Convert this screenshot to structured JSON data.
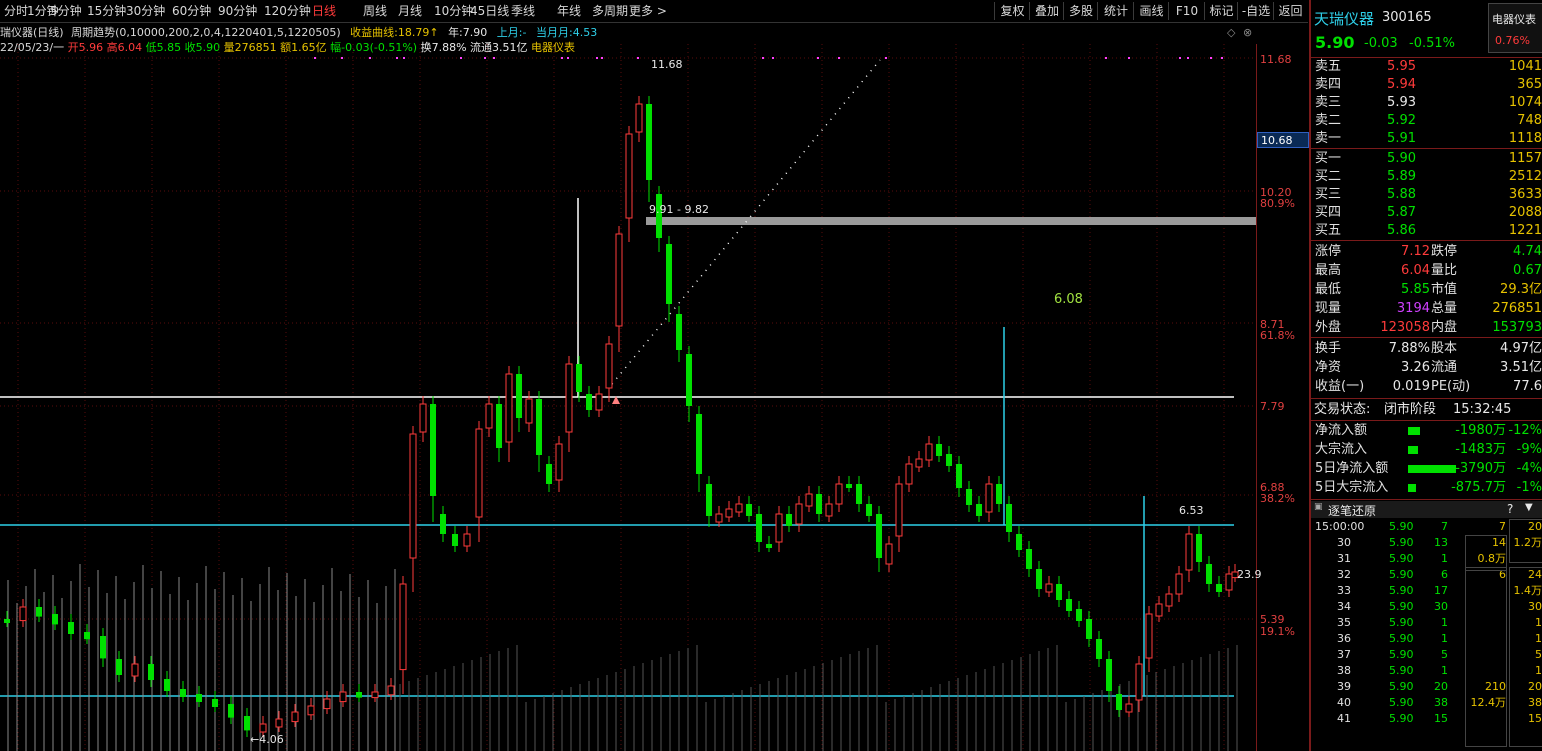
{
  "toolbar": {
    "periods": [
      "分时",
      "1分钟",
      "5分钟",
      "15分钟",
      "30分钟",
      "60分钟",
      "90分钟",
      "120分钟",
      "日线",
      "周线",
      "月线",
      "10分钟",
      "45日线",
      "季线",
      "年线",
      "多周期",
      "更多 >"
    ],
    "active_period": "日线",
    "tools": [
      "复权",
      "叠加",
      "多股",
      "统计",
      "画线",
      "F10",
      "标记",
      "-自选",
      "返回"
    ]
  },
  "info_line1": {
    "name": "瑞仪器(日线)",
    "indicator": "周期趋势(0,10000,200,2,0,4,1220401,5,1220505)",
    "curve_label": "收益曲线:",
    "curve_value": "18.79↑",
    "year_label": "年:",
    "year_value": "7.90",
    "lastmonth_label": "上月:",
    "lastmonth_value": "-",
    "thismonth_label": "当月月:",
    "thismonth_value": "4.53"
  },
  "info_line2": {
    "date": "22/05/23/一",
    "open_label": "开",
    "open": "5.96",
    "high_label": "高",
    "high": "6.04",
    "low_label": "低",
    "low": "5.85",
    "close_label": "收",
    "close": "5.90",
    "vol_label": "量",
    "vol": "276851",
    "amount_label": "额",
    "amount": "1.65亿",
    "chg_label": "幅",
    "chg": "-0.03(-0.51%)",
    "turnover_label": "换",
    "turnover": "7.88%",
    "float_label": "流通",
    "float": "3.51亿",
    "sector": "电器仪表"
  },
  "chart": {
    "price_labels": [
      "11.68",
      "10.20",
      "8.71",
      "7.79",
      "6.88",
      "5.39"
    ],
    "pct_labels": [
      "80.9%",
      "61.8%",
      "38.2%",
      "19.1%"
    ],
    "crosshair_price": "10.68",
    "annotations": {
      "peak": "11.68",
      "low": "4.06",
      "range": "9.91 - 9.82",
      "mid": "6.08",
      "local_high": "6.53",
      "last": "23.9"
    }
  },
  "panel": {
    "stock_name": "天瑞仪器",
    "stock_code": "300165",
    "sector_badge": "电器仪表",
    "sector_pct": "0.76%",
    "price": "5.90",
    "change": "-0.03",
    "change_pct": "-0.51%",
    "asks": [
      {
        "label": "卖五",
        "price": "5.95",
        "vol": "1041"
      },
      {
        "label": "卖四",
        "price": "5.94",
        "vol": "365"
      },
      {
        "label": "卖三",
        "price": "5.93",
        "vol": "1074"
      },
      {
        "label": "卖二",
        "price": "5.92",
        "vol": "748"
      },
      {
        "label": "卖一",
        "price": "5.91",
        "vol": "1118"
      }
    ],
    "bids": [
      {
        "label": "买一",
        "price": "5.90",
        "vol": "1157"
      },
      {
        "label": "买二",
        "price": "5.89",
        "vol": "2512"
      },
      {
        "label": "买三",
        "price": "5.88",
        "vol": "3633"
      },
      {
        "label": "买四",
        "price": "5.87",
        "vol": "2088"
      },
      {
        "label": "买五",
        "price": "5.86",
        "vol": "1221"
      }
    ],
    "stats1": [
      {
        "l1": "涨停",
        "v1": "7.12",
        "l2": "跌停",
        "v2": "4.74"
      },
      {
        "l1": "最高",
        "v1": "6.04",
        "l2": "量比",
        "v2": "0.67"
      },
      {
        "l1": "最低",
        "v1": "5.85",
        "l2": "市值",
        "v2": "29.3亿"
      },
      {
        "l1": "现量",
        "v1": "3194",
        "l2": "总量",
        "v2": "276851"
      },
      {
        "l1": "外盘",
        "v1": "123058",
        "l2": "内盘",
        "v2": "153793"
      }
    ],
    "stats2": [
      {
        "l1": "换手",
        "v1": "7.88%",
        "l2": "股本",
        "v2": "4.97亿"
      },
      {
        "l1": "净资",
        "v1": "3.26",
        "l2": "流通",
        "v2": "3.51亿"
      },
      {
        "l1": "收益(一)",
        "v1": "0.019",
        "l2": "PE(动)",
        "v2": "77.6"
      }
    ],
    "trade_status_label": "交易状态:",
    "trade_status": "闭市阶段",
    "trade_time": "15:32:45",
    "flows": [
      {
        "label": "净流入额",
        "value": "-1980万",
        "pct": "-12%"
      },
      {
        "label": "大宗流入",
        "value": "-1483万",
        "pct": "-9%"
      },
      {
        "label": "5日净流入额",
        "value": "-3790万",
        "pct": "-4%"
      },
      {
        "label": "5日大宗流入",
        "value": "-875.7万",
        "pct": "-1%"
      }
    ],
    "ticks_title": "逐笔还原",
    "ticks_help": "?",
    "ticks": [
      {
        "t": "15:00:00",
        "p": "5.90",
        "v": "7",
        "q": "7",
        "s": "20"
      },
      {
        "t": "30",
        "p": "5.90",
        "v": "13",
        "q": "14",
        "s": "1.2万"
      },
      {
        "t": "31",
        "p": "5.90",
        "v": "1",
        "q": "0.8万",
        "s": ""
      },
      {
        "t": "32",
        "p": "5.90",
        "v": "6",
        "q": "6",
        "s": "24"
      },
      {
        "t": "33",
        "p": "5.90",
        "v": "17",
        "q": "",
        "s": "1.4万"
      },
      {
        "t": "34",
        "p": "5.90",
        "v": "30",
        "q": "",
        "s": "30"
      },
      {
        "t": "35",
        "p": "5.90",
        "v": "1",
        "q": "",
        "s": "1"
      },
      {
        "t": "36",
        "p": "5.90",
        "v": "1",
        "q": "",
        "s": "1"
      },
      {
        "t": "37",
        "p": "5.90",
        "v": "5",
        "q": "",
        "s": "5"
      },
      {
        "t": "38",
        "p": "5.90",
        "v": "1",
        "q": "",
        "s": "1"
      },
      {
        "t": "39",
        "p": "5.90",
        "v": "20",
        "q": "210",
        "s": "20"
      },
      {
        "t": "40",
        "p": "5.90",
        "v": "38",
        "q": "12.4万",
        "s": "38"
      },
      {
        "t": "41",
        "p": "5.90",
        "v": "15",
        "q": "",
        "s": "15"
      }
    ]
  }
}
